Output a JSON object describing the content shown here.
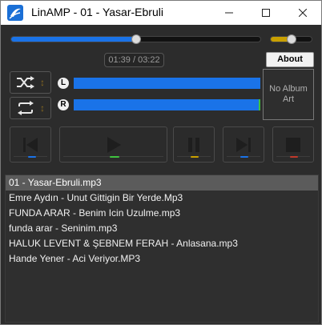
{
  "window": {
    "title": "LinAMP - 01 - Yasar-Ebruli",
    "app_icon": "linamp-logo-icon",
    "controls": {
      "minimize": "minimize-icon",
      "maximize": "maximize-icon",
      "close": "close-icon"
    }
  },
  "player": {
    "time_display": "01:39 / 03:22",
    "seek_fraction": 0.5,
    "volume_fraction": 0.5,
    "about_label": "About",
    "album_art_text": "No Album Art",
    "left_channel_label": "L",
    "right_channel_label": "R",
    "left_level": 1.0,
    "right_level": 1.0,
    "colors": {
      "accent": "#1a73e8",
      "volume": "#c9a000",
      "peak": "#3fc23f"
    },
    "modes": [
      {
        "name": "shuffle",
        "icon": "shuffle-icon"
      },
      {
        "name": "repeat",
        "icon": "repeat-icon"
      }
    ],
    "transport": [
      {
        "name": "previous",
        "icon": "skip-back-icon",
        "led": "#1a73e8"
      },
      {
        "name": "play",
        "icon": "play-icon",
        "led": "#3fc23f"
      },
      {
        "name": "pause",
        "icon": "pause-icon",
        "led": "#c9a000"
      },
      {
        "name": "next",
        "icon": "skip-forward-icon",
        "led": "#1a73e8"
      },
      {
        "name": "stop",
        "icon": "stop-icon",
        "led": "#c0392b"
      }
    ]
  },
  "playlist": {
    "selected_index": 0,
    "items": [
      "01 - Yasar-Ebruli.mp3",
      "Emre Aydın - Unut Gittigin Bir Yerde.Mp3",
      "FUNDA ARAR - Benim Icin Uzulme.mp3",
      "funda arar - Seninim.mp3",
      "HALUK LEVENT & ŞEBNEM FERAH - Anlasana.mp3",
      "Hande Yener - Aci Veriyor.MP3"
    ]
  }
}
